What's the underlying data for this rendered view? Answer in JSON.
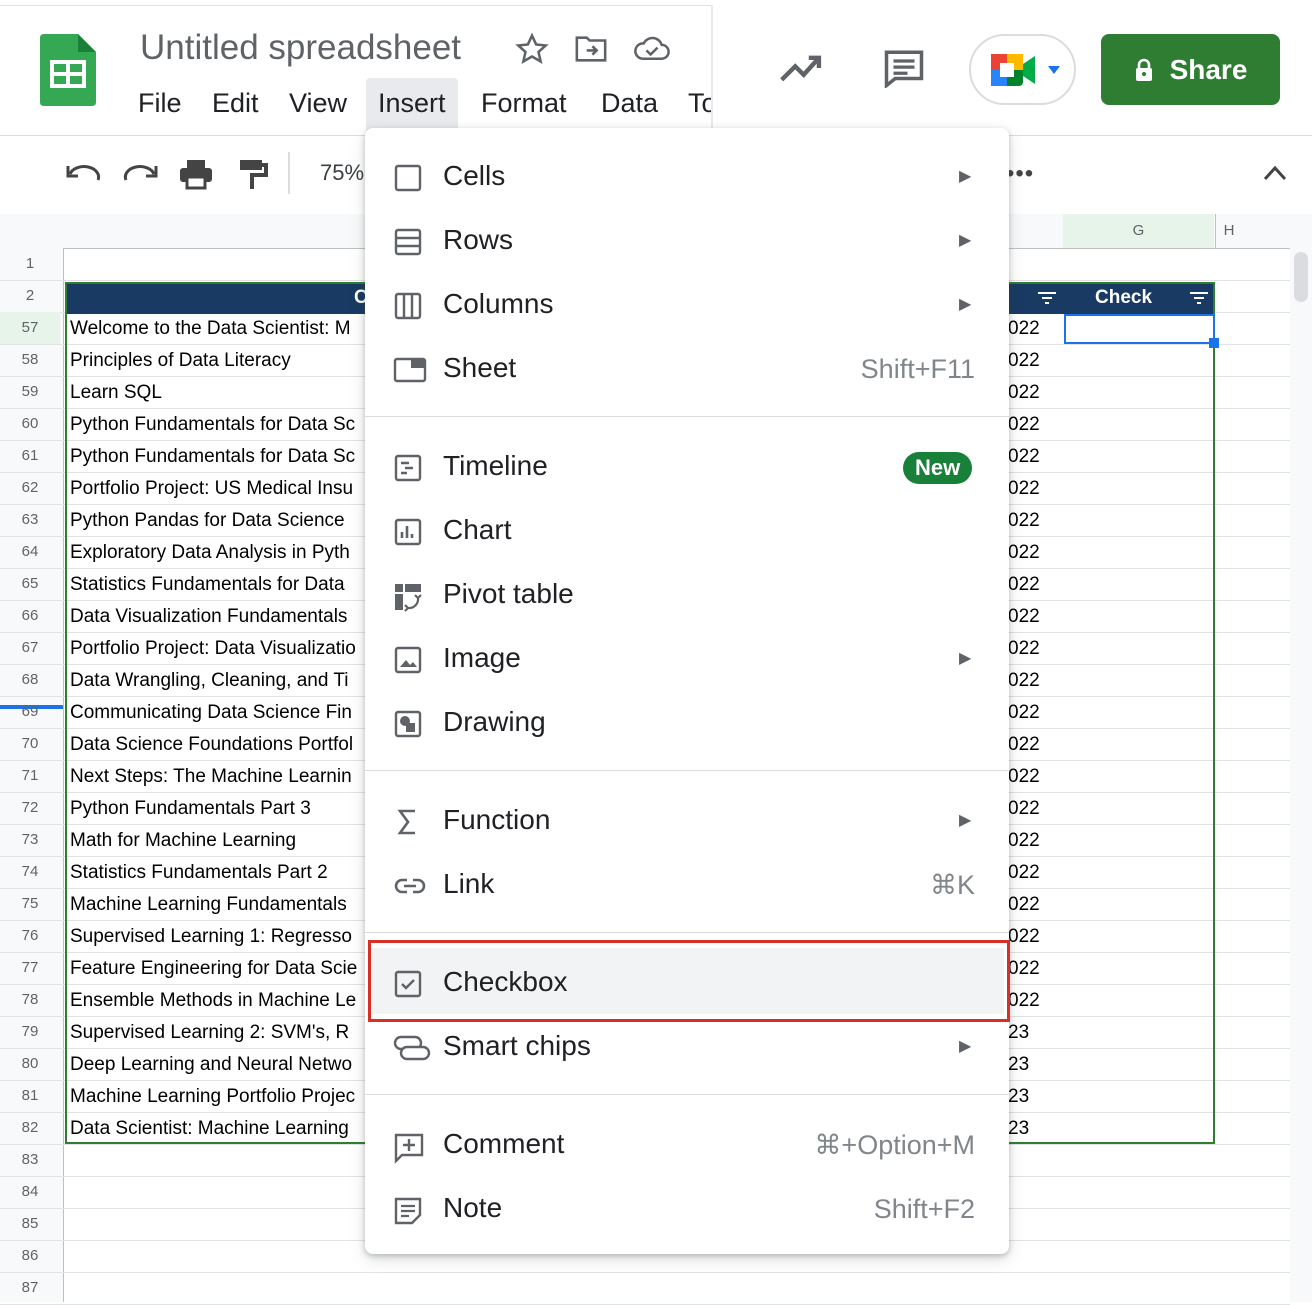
{
  "app": {
    "title": "Untitled spreadsheet",
    "accent": "#2e7d32"
  },
  "menubar": [
    "File",
    "Edit",
    "View",
    "Insert",
    "Format",
    "Data",
    "To"
  ],
  "header": {
    "share_label": "Share"
  },
  "toolbar": {
    "zoom": "75%"
  },
  "columns": {
    "g_label": "G",
    "h_label": "H"
  },
  "table": {
    "header_label": "C",
    "check_label": "Check",
    "header_color": "#183a63"
  },
  "row_numbers": [
    "1",
    "2",
    "57",
    "58",
    "59",
    "60",
    "61",
    "62",
    "63",
    "64",
    "65",
    "66",
    "67",
    "68",
    "69",
    "70",
    "71",
    "72",
    "73",
    "74",
    "75",
    "76",
    "77",
    "78",
    "79",
    "80",
    "81",
    "82",
    "83",
    "84",
    "85",
    "86",
    "87"
  ],
  "rows": [
    {
      "text": "Welcome to the Data Scientist: M",
      "year": "022"
    },
    {
      "text": "Principles of Data Literacy",
      "year": "022"
    },
    {
      "text": "Learn SQL",
      "year": "022"
    },
    {
      "text": "Python Fundamentals for Data Sc",
      "year": "022"
    },
    {
      "text": "Python Fundamentals for Data Sc",
      "year": "022"
    },
    {
      "text": "Portfolio Project: US Medical Insu",
      "year": "022"
    },
    {
      "text": "Python Pandas for Data Science",
      "year": "022"
    },
    {
      "text": "Exploratory Data Analysis in Pyth",
      "year": "022"
    },
    {
      "text": "Statistics Fundamentals for Data",
      "year": "022"
    },
    {
      "text": "Data Visualization Fundamentals",
      "year": "022"
    },
    {
      "text": "Portfolio Project: Data Visualizatio",
      "year": "022"
    },
    {
      "text": "Data Wrangling, Cleaning, and Ti",
      "year": "022"
    },
    {
      "text": "Communicating Data Science Fin",
      "year": "022"
    },
    {
      "text": "Data Science Foundations Portfol",
      "year": "022"
    },
    {
      "text": "Next Steps: The Machine Learnin",
      "year": "022"
    },
    {
      "text": "Python Fundamentals Part 3",
      "year": "022"
    },
    {
      "text": "Math for Machine Learning",
      "year": "022"
    },
    {
      "text": "Statistics Fundamentals Part 2",
      "year": "022"
    },
    {
      "text": "Machine Learning Fundamentals",
      "year": "022"
    },
    {
      "text": "Supervised Learning 1: Regresso",
      "year": "022"
    },
    {
      "text": "Feature Engineering for Data Scie",
      "year": "022"
    },
    {
      "text": "Ensemble Methods in Machine Le",
      "year": "022"
    },
    {
      "text": "Supervised Learning 2: SVM's, R",
      "year": "23"
    },
    {
      "text": "Deep Learning and Neural Netwo",
      "year": "23"
    },
    {
      "text": "Machine Learning Portfolio Projec",
      "year": "23"
    },
    {
      "text": "Data Scientist: Machine Learning",
      "year": "23"
    }
  ],
  "insert_menu": {
    "cells": "Cells",
    "rows": "Rows",
    "columns": "Columns",
    "sheet": "Sheet",
    "sheet_shortcut": "Shift+F11",
    "timeline": "Timeline",
    "timeline_badge": "New",
    "chart": "Chart",
    "pivot": "Pivot table",
    "image": "Image",
    "drawing": "Drawing",
    "function": "Function",
    "link": "Link",
    "link_shortcut": "⌘K",
    "checkbox": "Checkbox",
    "smart_chips": "Smart chips",
    "comment": "Comment",
    "comment_shortcut": "⌘+Option+M",
    "note": "Note",
    "note_shortcut": "Shift+F2",
    "highlight_color": "#d93025"
  }
}
